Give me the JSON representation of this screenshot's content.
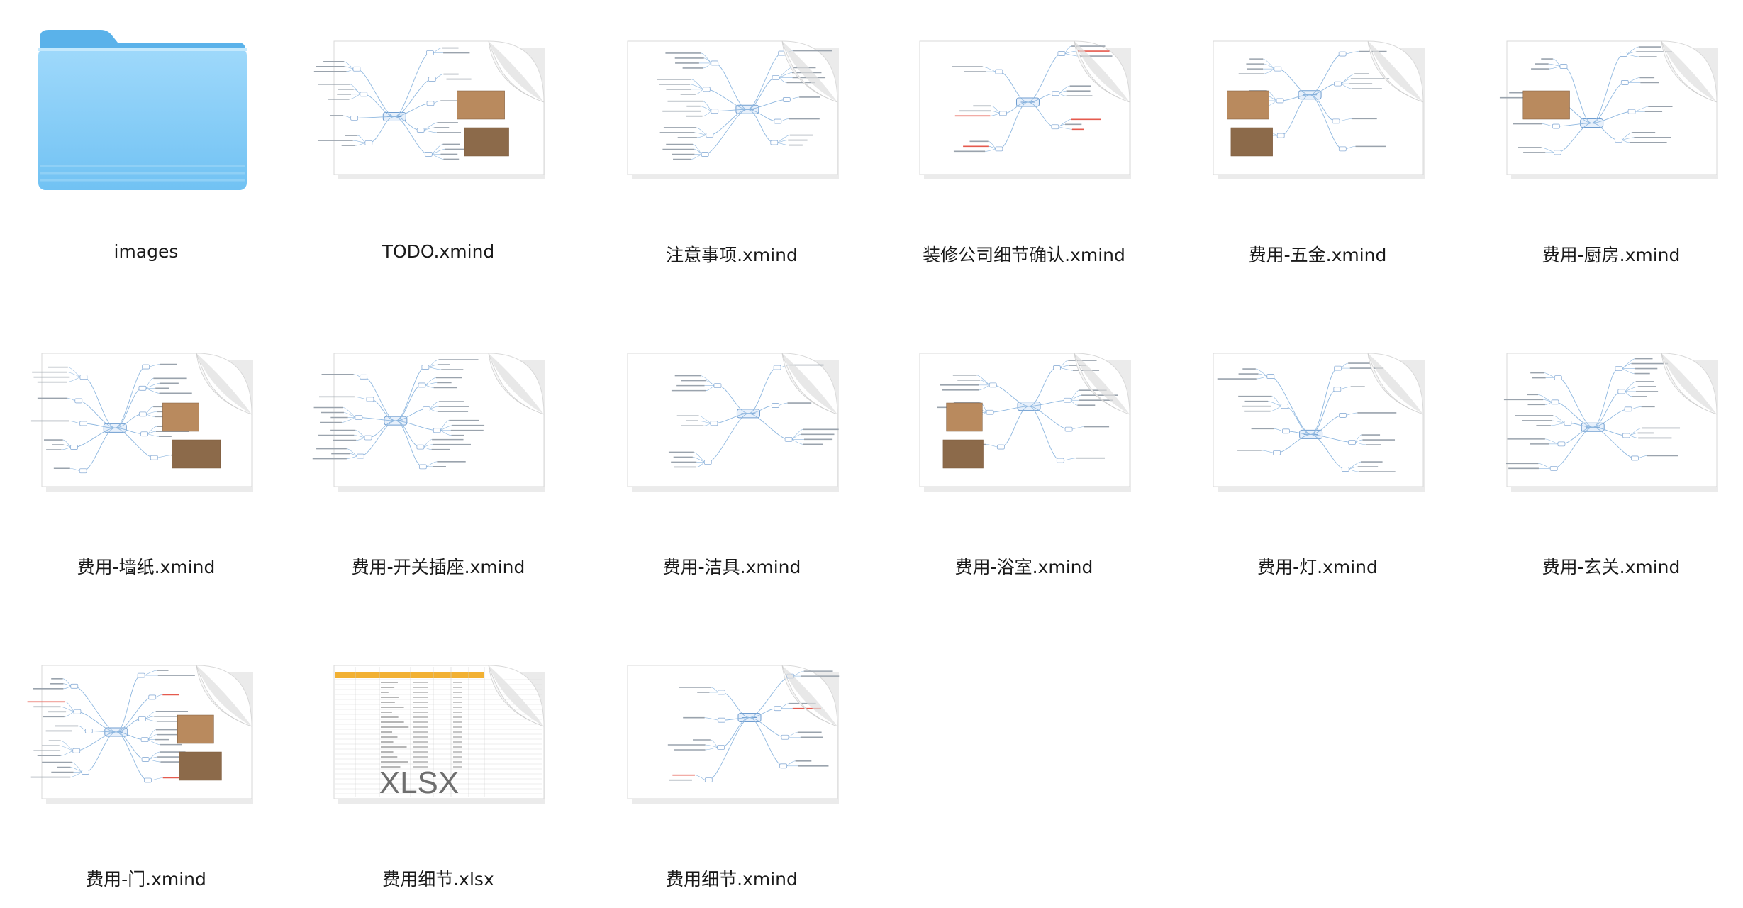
{
  "window": {
    "view": "icon-view"
  },
  "files": [
    {
      "name": "images",
      "kind": "folder",
      "icon": "folder-icon"
    },
    {
      "name": "TODO.xmind",
      "kind": "xmind",
      "icon": "xmind-thumbnail-icon",
      "photos": true
    },
    {
      "name": "注意事项.xmind",
      "kind": "xmind",
      "icon": "xmind-thumbnail-icon"
    },
    {
      "name": "装修公司细节确认.xmind",
      "kind": "xmind",
      "icon": "xmind-thumbnail-icon",
      "red": true
    },
    {
      "name": "费用-五金.xmind",
      "kind": "xmind",
      "icon": "xmind-thumbnail-icon",
      "photos": true
    },
    {
      "name": "费用-厨房.xmind",
      "kind": "xmind",
      "icon": "xmind-thumbnail-icon",
      "photos": true
    },
    {
      "name": "费用-墙纸.xmind",
      "kind": "xmind",
      "icon": "xmind-thumbnail-icon",
      "photos": true
    },
    {
      "name": "费用-开关插座.xmind",
      "kind": "xmind",
      "icon": "xmind-thumbnail-icon"
    },
    {
      "name": "费用-洁具.xmind",
      "kind": "xmind",
      "icon": "xmind-thumbnail-icon"
    },
    {
      "name": "费用-浴室.xmind",
      "kind": "xmind",
      "icon": "xmind-thumbnail-icon",
      "photos": true
    },
    {
      "name": "费用-灯.xmind",
      "kind": "xmind",
      "icon": "xmind-thumbnail-icon"
    },
    {
      "name": "费用-玄关.xmind",
      "kind": "xmind",
      "icon": "xmind-thumbnail-icon",
      "red": true
    },
    {
      "name": "费用-门.xmind",
      "kind": "xmind",
      "icon": "xmind-thumbnail-icon",
      "photos": true,
      "red": true
    },
    {
      "name": "费用细节.xlsx",
      "kind": "xlsx",
      "icon": "spreadsheet-thumbnail-icon",
      "badge": "XLSX"
    },
    {
      "name": "费用细节.xmind",
      "kind": "xmind",
      "icon": "xmind-thumbnail-icon",
      "red": true
    }
  ],
  "colors": {
    "folder_light": "#9fd9fb",
    "folder_mid": "#71c2f3",
    "folder_dark": "#5ab2ea",
    "mindmap_line": "#8fb8e0",
    "mindmap_node": "#c8ddf3",
    "xlsx_header": "#f2b133",
    "xlsx_badge": "#6e6e6e"
  }
}
